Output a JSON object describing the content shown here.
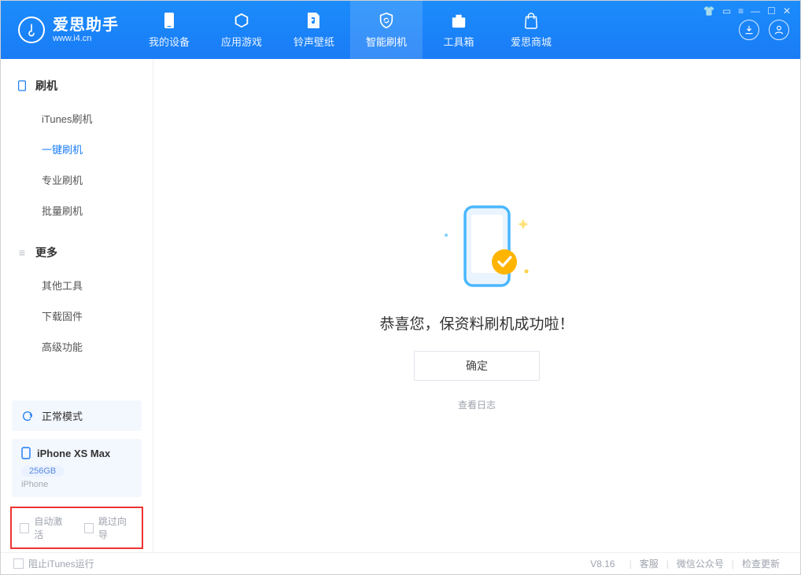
{
  "app": {
    "title": "爱思助手",
    "url": "www.i4.cn"
  },
  "nav": {
    "items": [
      {
        "label": "我的设备"
      },
      {
        "label": "应用游戏"
      },
      {
        "label": "铃声壁纸"
      },
      {
        "label": "智能刷机"
      },
      {
        "label": "工具箱"
      },
      {
        "label": "爱思商城"
      }
    ]
  },
  "sidebar": {
    "section1": {
      "title": "刷机",
      "items": [
        "iTunes刷机",
        "一键刷机",
        "专业刷机",
        "批量刷机"
      ]
    },
    "section2": {
      "title": "更多",
      "items": [
        "其他工具",
        "下载固件",
        "高级功能"
      ]
    }
  },
  "device": {
    "mode_label": "正常模式",
    "model": "iPhone XS Max",
    "capacity": "256GB",
    "type": "iPhone"
  },
  "options": {
    "auto_activate": "自动激活",
    "skip_guide": "跳过向导"
  },
  "main": {
    "message": "恭喜您，保资料刷机成功啦！",
    "ok": "确定",
    "view_log": "查看日志"
  },
  "footer": {
    "block_itunes": "阻止iTunes运行",
    "version": "V8.16",
    "links": [
      "客服",
      "微信公众号",
      "检查更新"
    ]
  }
}
